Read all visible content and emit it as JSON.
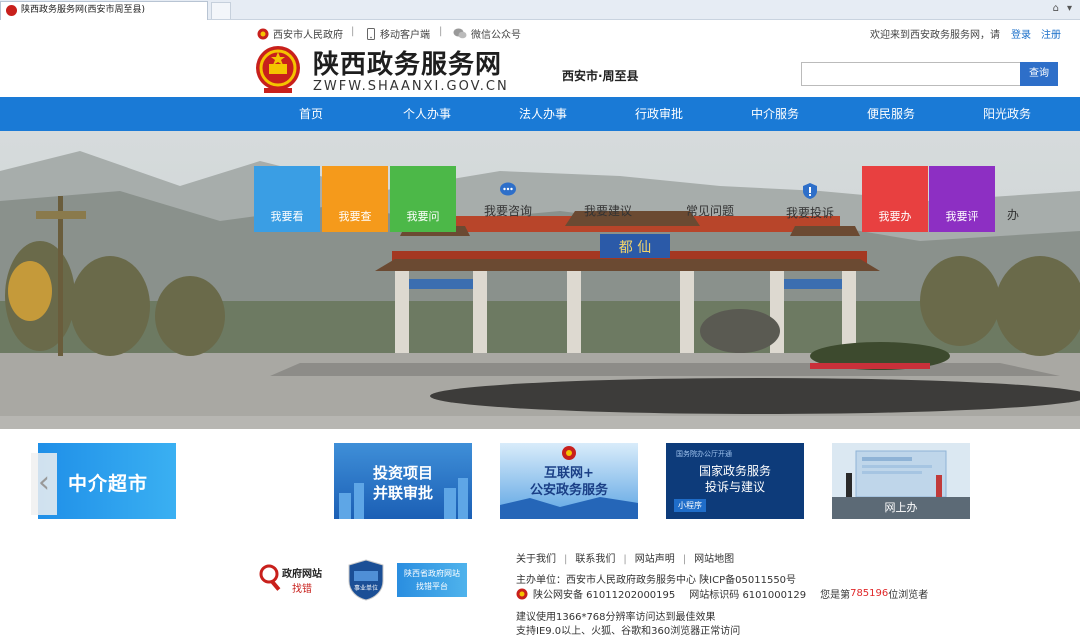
{
  "browser": {
    "tab_title": "陕西政务服务网(西安市周至县)",
    "icons": [
      "home-icon",
      "dropdown-icon"
    ]
  },
  "topbar": {
    "gov_link": "西安市人民政府",
    "mobile_link": "移动客户端",
    "wechat_link": "微信公众号",
    "separator": "|",
    "welcome": "欢迎来到西安政务服务网，请",
    "login": "登录",
    "register": "注册"
  },
  "header": {
    "title": "陕西政务服务网",
    "domain": "ZWFW.SHAANXI.GOV.CN",
    "region": "西安市·周至县",
    "search_button": "查询",
    "search_value": ""
  },
  "nav": {
    "items": [
      "首页",
      "个人办事",
      "法人办事",
      "行政审批",
      "中介服务",
      "便民服务",
      "阳光政务"
    ]
  },
  "banner": {
    "gate_plaque": "都  仙",
    "tiles": [
      {
        "label": "我要看",
        "color": "#3a9ee4"
      },
      {
        "label": "我要查",
        "color": "#f59a1b"
      },
      {
        "label": "我要问",
        "color": "#4cb848"
      },
      {
        "label": "我要办",
        "color": "#e84040"
      },
      {
        "label": "我要评",
        "color": "#8d2fc3"
      }
    ],
    "plain_items": [
      "我要咨询",
      "我要建议",
      "常见问题",
      "我要投诉"
    ],
    "overflow_label": "办"
  },
  "promos": {
    "items": [
      {
        "line1": "中介超市",
        "line2": ""
      },
      {
        "line1": "投资项目",
        "line2": "并联审批"
      },
      {
        "line1": "互联网+",
        "line2": "公安政务服务"
      },
      {
        "line1": "国家政务服务",
        "line2": "投诉与建议",
        "small_top": "国务院办公厅开通",
        "badge": "小程序"
      },
      {
        "line1": "网上办",
        "line2": ""
      }
    ],
    "prev_arrow": "‹"
  },
  "footer": {
    "links": [
      "关于我们",
      "联系我们",
      "网站声明",
      "网站地图"
    ],
    "sponsor": "主办单位：西安市人民政府政务服务中心    陕ICP备05011550号",
    "police_record": "陕公网安备 61011202000195",
    "site_id": "网站标识码 6101000129",
    "visitor_prefix": "您是第",
    "visitor_count": "785196",
    "visitor_suffix": "位浏览者",
    "tip1": "建议使用1366*768分辨率访问达到最佳效果",
    "tip2": "支持IE9.0以上、火狐、谷歌和360浏览器正常访问",
    "badge_error_line1": "政府网站",
    "badge_error_line2": "找错",
    "badge_unit": "事业单位",
    "badge_platform_line1": "陕西省政府网站",
    "badge_platform_line2": "找错平台"
  },
  "colors": {
    "nav": "#1a7ad6",
    "link": "#1a6fc9",
    "visitor_count": "#e0282a"
  }
}
